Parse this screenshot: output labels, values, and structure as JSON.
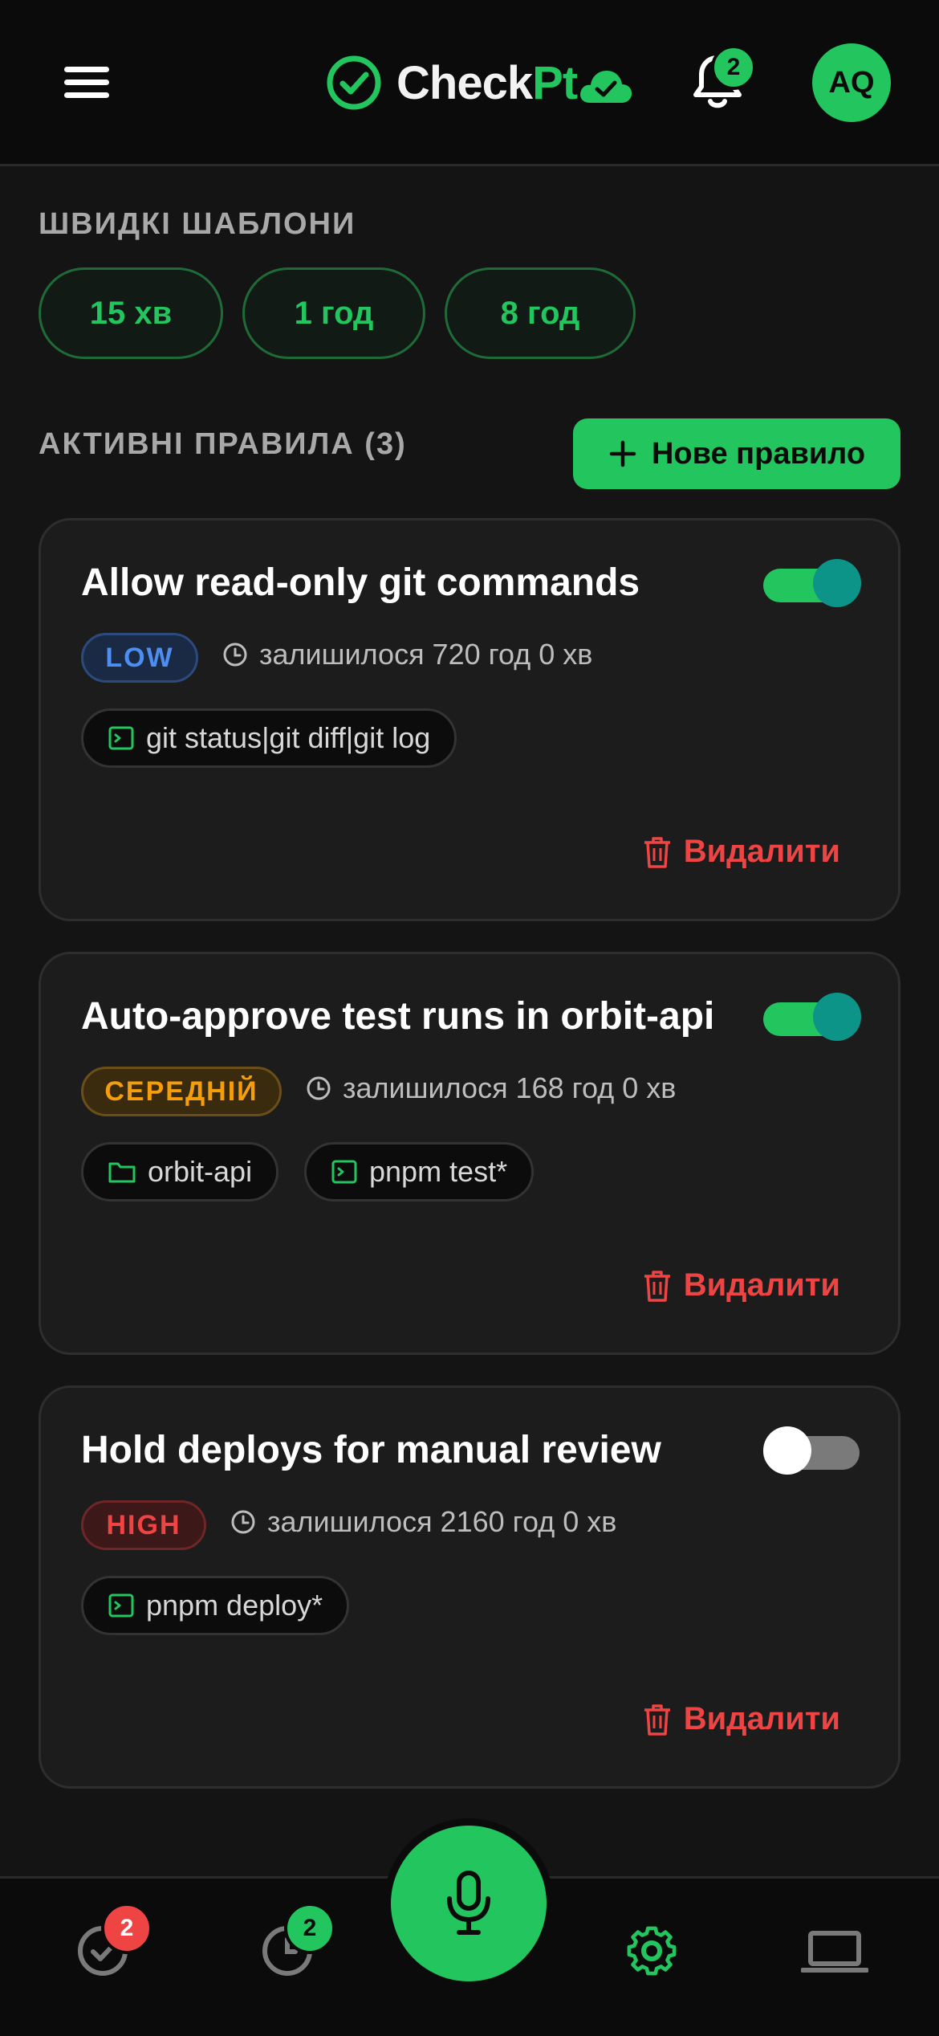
{
  "header": {
    "logo_text_primary": "Check",
    "logo_text_accent": "Pt",
    "notifications_count": "2",
    "avatar_initials": "AQ"
  },
  "quick_templates": {
    "title": "ШВИДКІ ШАБЛОНИ",
    "chips": [
      "15 хв",
      "1 год",
      "8 год"
    ]
  },
  "active_rules": {
    "title": "АКТИВНІ ПРАВИЛА (3)",
    "new_rule_label": "Нове правило",
    "delete_label": "Видалити",
    "rules": [
      {
        "title": "Allow read-only git commands",
        "enabled": true,
        "severity": "LOW",
        "remaining": "залишилося 720 год 0 хв",
        "tags": [
          {
            "icon": "terminal-icon",
            "text": "git status|git diff|git log"
          }
        ]
      },
      {
        "title": "Auto-approve test runs in orbit-api",
        "enabled": true,
        "severity": "СЕРЕДНІЙ",
        "remaining": "залишилося 168 год 0 хв",
        "tags": [
          {
            "icon": "folder-icon",
            "text": "orbit-api"
          },
          {
            "icon": "terminal-icon",
            "text": "pnpm test*"
          }
        ]
      },
      {
        "title": "Hold deploys for manual review",
        "enabled": false,
        "severity": "HIGH",
        "remaining": "залишилося 2160 год 0 хв",
        "tags": [
          {
            "icon": "terminal-icon",
            "text": "pnpm deploy*"
          }
        ]
      }
    ]
  },
  "bottom_nav": {
    "approvals_badge": "2",
    "history_badge": "2"
  },
  "colors": {
    "accent": "#22c55e",
    "danger": "#ef4444",
    "warning": "#f59e0b",
    "info": "#4d8ef0",
    "toggle_knob_on": "#0d9488"
  }
}
